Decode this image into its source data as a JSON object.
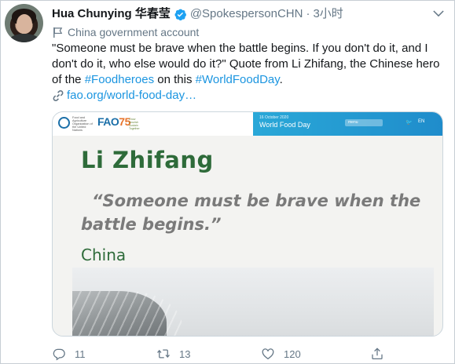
{
  "tweet": {
    "display_name": "Hua Chunying 华春莹",
    "handle": "@SpokespersonCHN",
    "separator": "·",
    "time": "3小时",
    "account_label": "China government account",
    "text_part1": "\"Someone must be brave when the battle begins. If you don't do it, and I don't do it, who else would do it?\" Quote from Li Zhifang, the Chinese hero of the ",
    "hashtag1": "#Foodheroes",
    "text_part2": " on this ",
    "hashtag2": "#WorldFoodDay",
    "text_part3": ".",
    "link_text": "fao.org/world-food-day…"
  },
  "card": {
    "fao_small_text": "Food and Agriculture Organization of the United Nations",
    "fao75_prefix": "FAO",
    "fao75_number": "75",
    "fao75_sub": "Grow Nourish Sustain Together",
    "wfd_date": "16 October 2020",
    "wfd_title": "World Food Day",
    "wfd_search": "menu",
    "wfd_lang": "EN",
    "name": "Li Zhifang",
    "quote": "“Someone must be brave when the battle begins.”",
    "country": "China"
  },
  "actions": {
    "reply_count": "11",
    "retweet_count": "13",
    "like_count": "120"
  },
  "colors": {
    "link": "#1b95e0",
    "verified": "#1da1f2",
    "secondary_text": "#657786",
    "card_green": "#2e6b3a"
  },
  "icons": [
    "verified-badge-icon",
    "caret-down-icon",
    "flag-icon",
    "link-icon",
    "reply-icon",
    "retweet-icon",
    "like-icon",
    "share-icon"
  ]
}
